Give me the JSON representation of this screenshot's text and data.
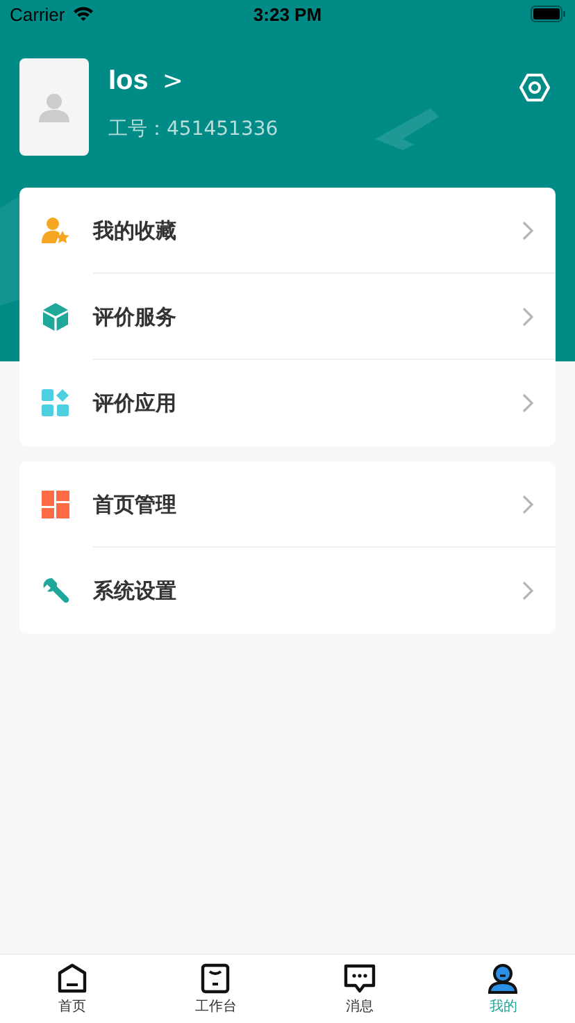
{
  "status_bar": {
    "carrier": "Carrier",
    "time": "3:23 PM"
  },
  "profile": {
    "name": "Ios",
    "chevron": ">",
    "employee_id": "工号：451451336"
  },
  "menu_groups": [
    {
      "items": [
        {
          "kind": "favorite",
          "label": "我的收藏"
        },
        {
          "kind": "cube",
          "label": "评价服务"
        },
        {
          "kind": "apps",
          "label": "评价应用"
        }
      ]
    },
    {
      "items": [
        {
          "kind": "dashboard",
          "label": "首页管理"
        },
        {
          "kind": "wrench",
          "label": "系统设置"
        }
      ]
    }
  ],
  "tabs": [
    {
      "kind": "home",
      "label": "首页",
      "selected": false
    },
    {
      "kind": "workbench",
      "label": "工作台",
      "selected": false
    },
    {
      "kind": "message",
      "label": "消息",
      "selected": false
    },
    {
      "kind": "profile",
      "label": "我的",
      "selected": true
    }
  ]
}
